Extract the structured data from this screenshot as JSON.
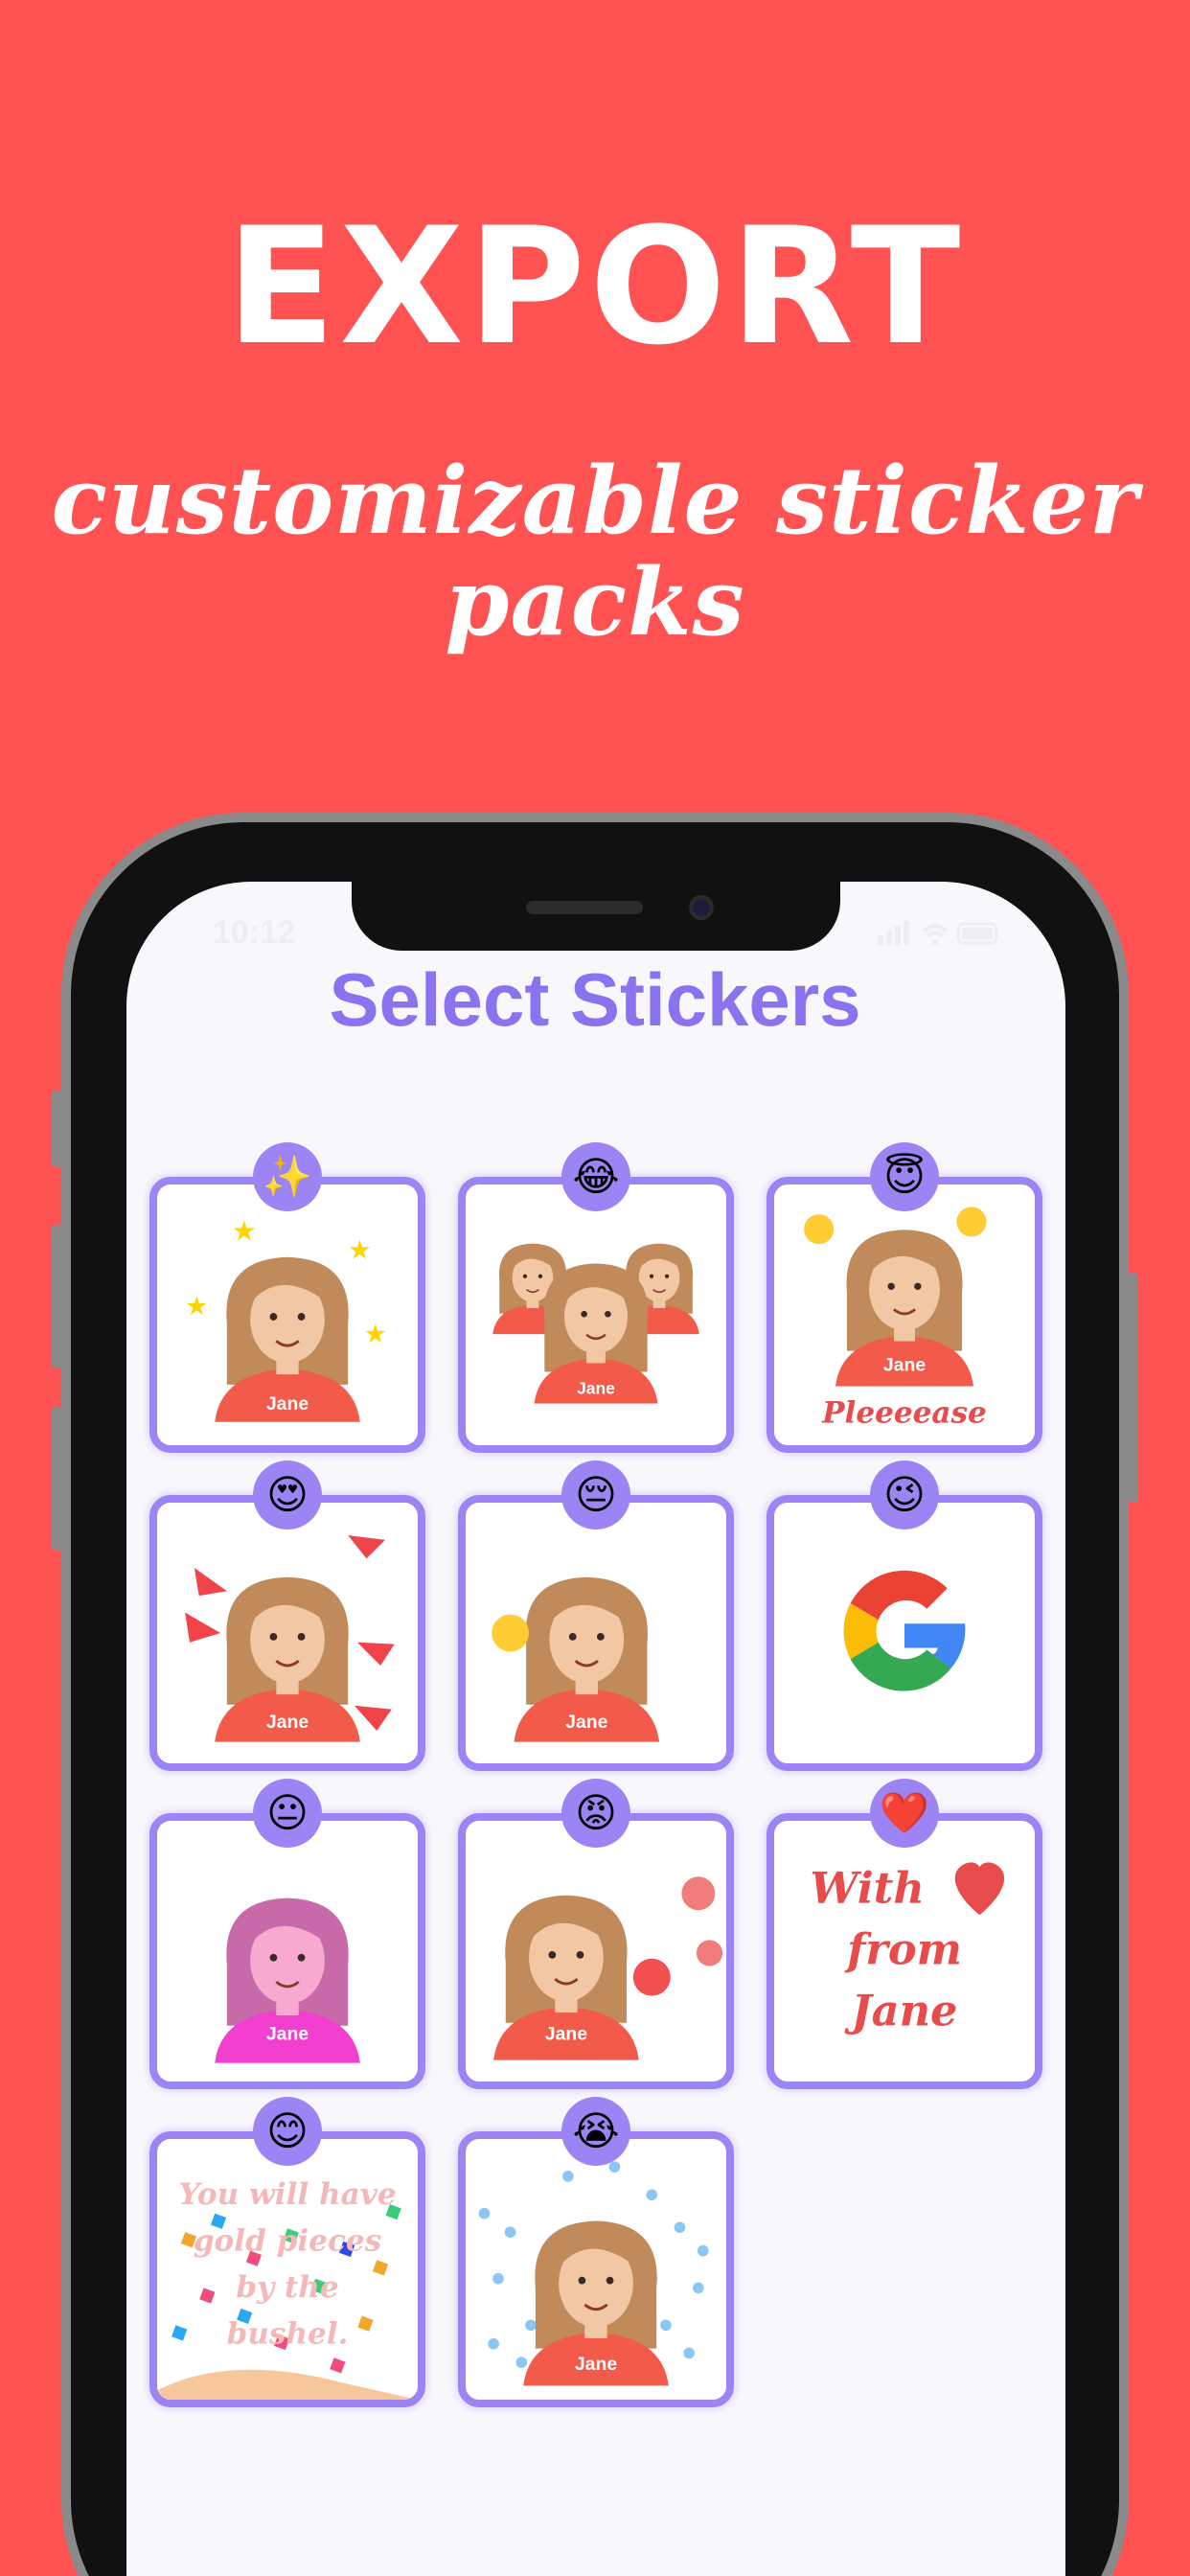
{
  "headline": {
    "title": "EXPORT",
    "subtitle": "customizable sticker packs"
  },
  "status_bar": {
    "time": "10:12",
    "icons": "signal wifi battery"
  },
  "screen": {
    "title": "Select Stickers"
  },
  "stickers": [
    {
      "badge": "✨",
      "badge_icon": "sparkles-icon",
      "label": "Jane"
    },
    {
      "badge": "😂",
      "badge_icon": "tears-of-joy-icon",
      "label": "Jane"
    },
    {
      "badge": "😇",
      "badge_icon": "halo-smile-icon",
      "label": "Jane",
      "caption": "Pleeeease"
    },
    {
      "badge": "😍",
      "badge_icon": "heart-eyes-icon",
      "label": "Jane"
    },
    {
      "badge": "😔",
      "badge_icon": "pensive-icon",
      "label": "Jane"
    },
    {
      "badge": "😉",
      "badge_icon": "wink-icon",
      "label": ""
    },
    {
      "badge": "😐",
      "badge_icon": "neutral-face-icon",
      "label": "Jane"
    },
    {
      "badge": "😡",
      "badge_icon": "angry-face-icon",
      "label": "Jane"
    },
    {
      "badge": "❤️",
      "badge_icon": "red-heart-icon",
      "lines": [
        "With",
        "from",
        "Jane"
      ]
    },
    {
      "badge": "😊",
      "badge_icon": "smiling-face-icon",
      "lines": [
        "You will have",
        "gold pieces",
        "by the",
        "bushel."
      ]
    },
    {
      "badge": "😭",
      "badge_icon": "crying-face-icon",
      "label": "Jane"
    }
  ],
  "colors": {
    "background": "#FF5252",
    "accent": "#9C84F4",
    "title": "#8B72EE",
    "shirt": "#F25A4A",
    "hair": "#C08A5A",
    "skin": "#F2C7A3"
  }
}
